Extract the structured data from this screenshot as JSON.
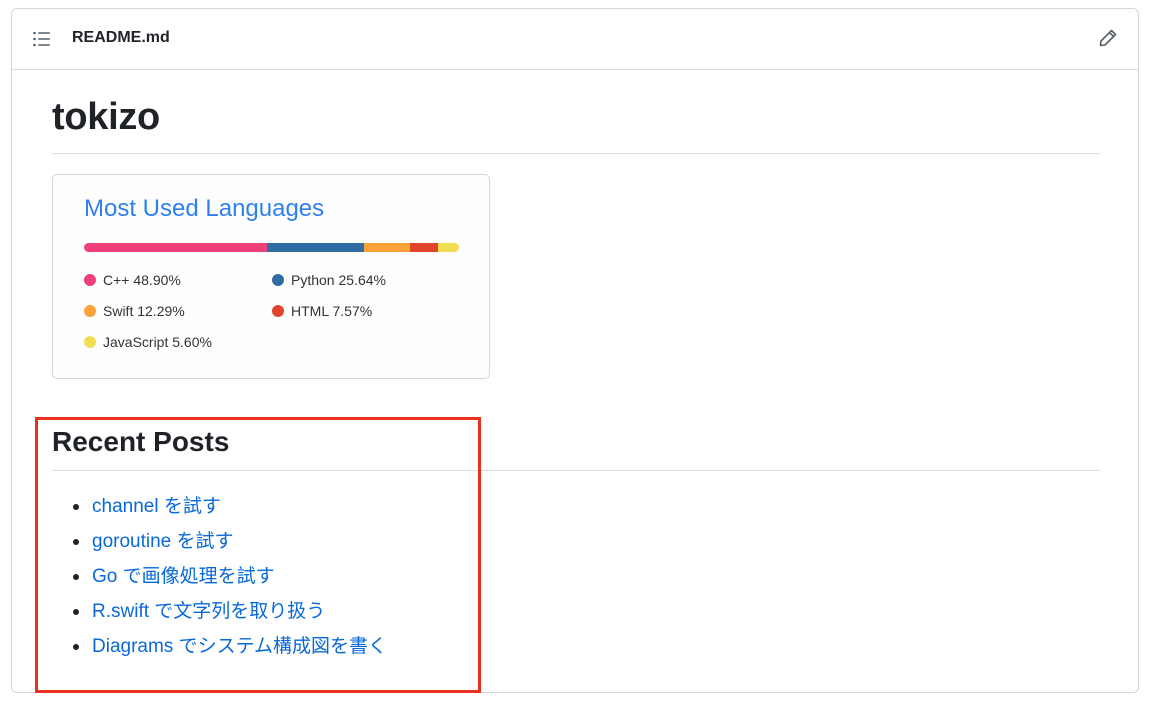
{
  "header": {
    "filename": "README.md",
    "toc_icon": "list-unordered-icon",
    "edit_icon": "pencil-icon"
  },
  "readme": {
    "title": "tokizo",
    "languages_card": {
      "title": "Most Used Languages",
      "title_color": "#2f80ed",
      "languages": [
        {
          "name": "C++",
          "percent": 48.9,
          "label": "C++ 48.90%",
          "color": "#f34b7d"
        },
        {
          "name": "Python",
          "percent": 25.64,
          "label": "Python 25.64%",
          "color": "#3572A5"
        },
        {
          "name": "Swift",
          "percent": 12.29,
          "label": "Swift 12.29%",
          "color": "#F05138"
        },
        {
          "name": "HTML",
          "percent": 7.57,
          "label": "HTML 7.57%",
          "color": "#e34c26"
        },
        {
          "name": "JavaScript",
          "percent": 5.6,
          "label": "JavaScript 5.60%",
          "color": "#f1e05a"
        }
      ]
    },
    "recent_posts": {
      "heading": "Recent Posts",
      "items": [
        {
          "label": "channel を試す"
        },
        {
          "label": "goroutine を試す"
        },
        {
          "label": "Go で画像処理を試す"
        },
        {
          "label": "R.swift で文字列を取り扱う"
        },
        {
          "label": "Diagrams でシステム構成図を書く"
        }
      ]
    }
  },
  "colors": {
    "link": "#0969da",
    "highlight": "#e8311f",
    "border": "#d0d7de"
  }
}
